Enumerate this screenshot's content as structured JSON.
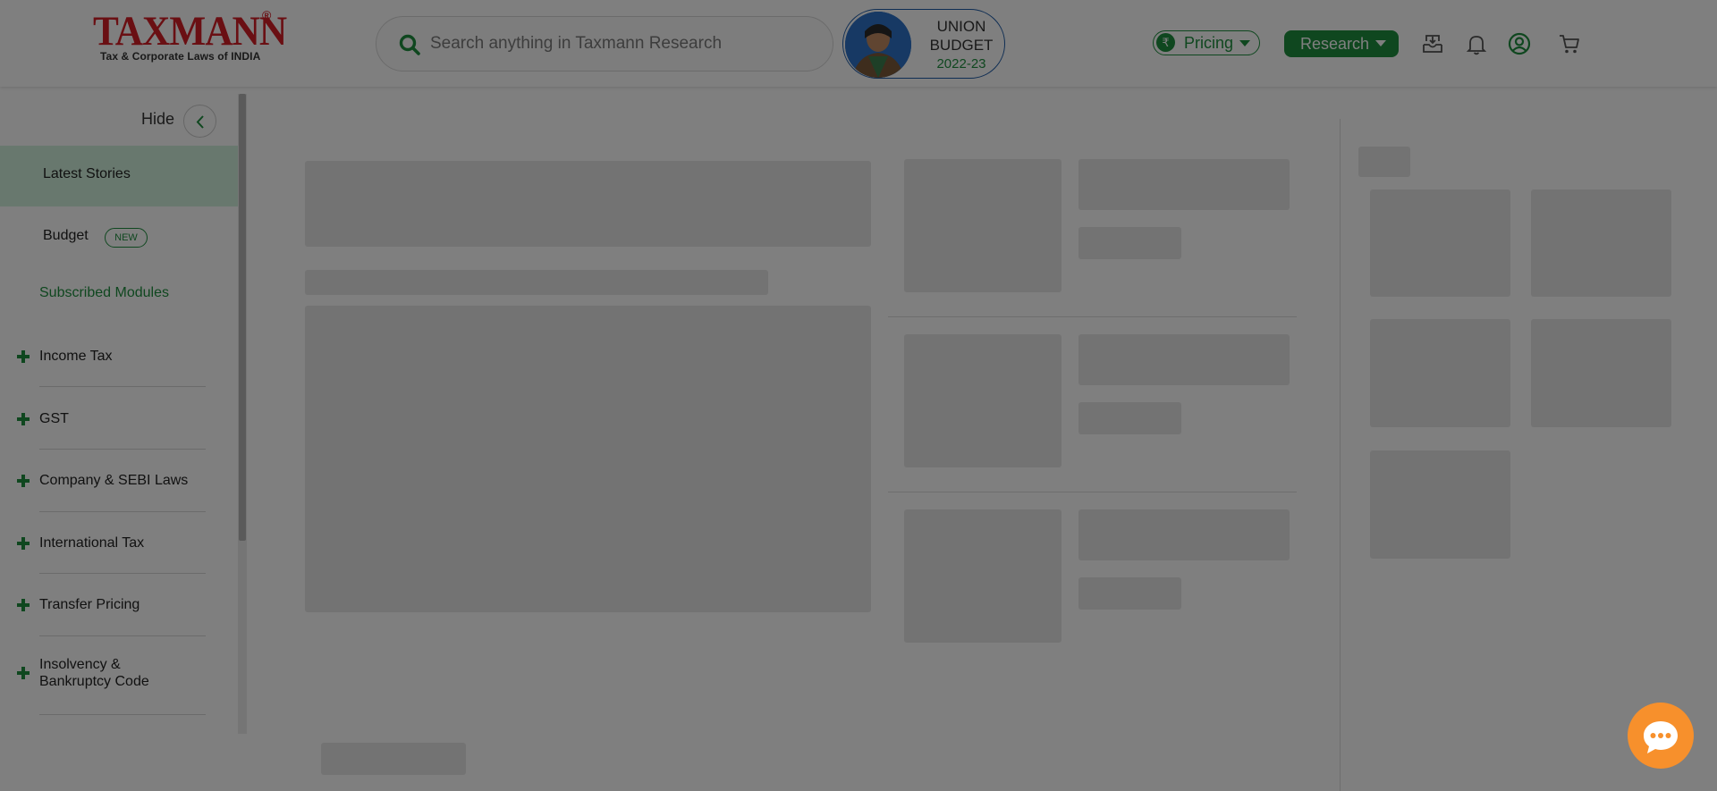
{
  "header": {
    "logo": {
      "name": "TAXMANN",
      "registered": "®",
      "tagline": "Tax & Corporate Laws of INDIA"
    },
    "search": {
      "placeholder": "Search anything in Taxmann Research",
      "value": ""
    },
    "budget_badge": {
      "line1": "UNION",
      "line2": "BUDGET",
      "year": "2022-23"
    },
    "pricing": {
      "label": "Pricing",
      "currency_symbol": "₹"
    },
    "research": {
      "label": "Research"
    },
    "icons": [
      "inbox-icon",
      "bell-icon",
      "user-account-icon",
      "cart-icon"
    ]
  },
  "sidebar": {
    "hide_label": "Hide",
    "latest_label": "Latest Stories",
    "budget_label": "Budget",
    "new_badge": "NEW",
    "subscribed_heading": "Subscribed Modules",
    "modules": [
      {
        "label": "Income Tax"
      },
      {
        "label": "GST"
      },
      {
        "label": "Company & SEBI Laws"
      },
      {
        "label": "International Tax"
      },
      {
        "label": "Transfer Pricing"
      },
      {
        "label": "Insolvency & Bankruptcy Code"
      }
    ]
  },
  "state": {
    "overlay": "page dimmed while content loads"
  },
  "colors": {
    "brand_red": "#d41f27",
    "accent_green": "#1e8e3e",
    "budget_blue": "#1d5aa6",
    "chat_orange": "#f7902c",
    "active_bg": "#d1f1dd"
  }
}
